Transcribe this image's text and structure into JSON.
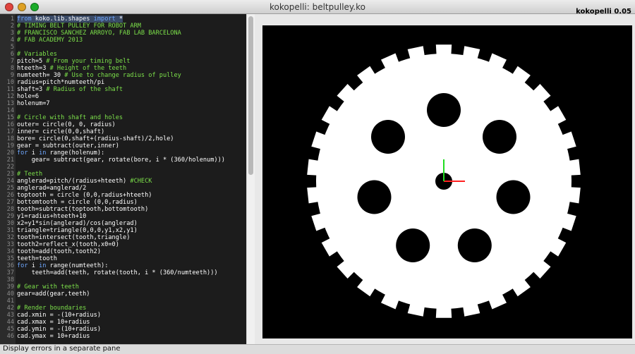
{
  "window": {
    "title": "kokopelli:  beltpulley.ko"
  },
  "app_label": "kokopelli 0.05",
  "status_text": "Display errors in a separate pane",
  "editor": {
    "line_numbers": [
      "1",
      "2",
      "3",
      "4",
      "5",
      "6",
      "7",
      "8",
      "9",
      "10",
      "11",
      "12",
      "13",
      "14",
      "15",
      "16",
      "17",
      "18",
      "19",
      "20",
      "21",
      "22",
      "23",
      "24",
      "25",
      "26",
      "27",
      "28",
      "29",
      "30",
      "31",
      "32",
      "33",
      "34",
      "35",
      "36",
      "37",
      "38",
      "39",
      "40",
      "41",
      "42",
      "43",
      "44",
      "45",
      "46"
    ],
    "lines": [
      [
        {
          "t": "from",
          "s": "k"
        },
        {
          "t": " koko.lib.shapes ",
          "s": "p"
        },
        {
          "t": "import",
          "s": "k"
        },
        {
          "t": " *",
          "s": "p"
        }
      ],
      [
        {
          "t": "# TIMING BELT PULLEY FOR ROBOT ARM",
          "s": "c"
        }
      ],
      [
        {
          "t": "# FRANCISCO SANCHEZ ARROYO, FAB LAB BARCELONA",
          "s": "c"
        }
      ],
      [
        {
          "t": "# FAB ACADEMY 2013",
          "s": "c"
        }
      ],
      [],
      [
        {
          "t": "# Variables",
          "s": "c"
        }
      ],
      [
        {
          "t": "pitch=5 ",
          "s": "p"
        },
        {
          "t": "# From your timing belt",
          "s": "c"
        }
      ],
      [
        {
          "t": "hteeth=3 ",
          "s": "p"
        },
        {
          "t": "# Height of the teeth",
          "s": "c"
        }
      ],
      [
        {
          "t": "numteeth= 30 ",
          "s": "p"
        },
        {
          "t": "# Use to change radius of pulley",
          "s": "c"
        }
      ],
      [
        {
          "t": "radius=pitch*numteeth/pi",
          "s": "p"
        }
      ],
      [
        {
          "t": "shaft=3 ",
          "s": "p"
        },
        {
          "t": "# Radius of the shaft",
          "s": "c"
        }
      ],
      [
        {
          "t": "hole=6",
          "s": "p"
        }
      ],
      [
        {
          "t": "holenum=7",
          "s": "p"
        }
      ],
      [],
      [
        {
          "t": "# Circle with shaft and holes",
          "s": "c"
        }
      ],
      [
        {
          "t": "outer= circle(0, 0, radius)",
          "s": "p"
        }
      ],
      [
        {
          "t": "inner= circle(0,0,shaft)",
          "s": "p"
        }
      ],
      [
        {
          "t": "bore= circle(0,shaft+(radius-shaft)/2,hole)",
          "s": "p"
        }
      ],
      [
        {
          "t": "gear = subtract(outer,inner)",
          "s": "p"
        }
      ],
      [
        {
          "t": "for",
          "s": "k"
        },
        {
          "t": " i ",
          "s": "p"
        },
        {
          "t": "in",
          "s": "k"
        },
        {
          "t": " range(holenum):",
          "s": "p"
        }
      ],
      [
        {
          "t": "    gear= subtract(gear, rotate(bore, i * (360/holenum)))",
          "s": "p"
        }
      ],
      [],
      [
        {
          "t": "# Teeth",
          "s": "c"
        }
      ],
      [
        {
          "t": "anglerad=pitch/(radius+hteeth) ",
          "s": "p"
        },
        {
          "t": "#CHECK",
          "s": "c"
        }
      ],
      [
        {
          "t": "anglerad=anglerad/2",
          "s": "p"
        }
      ],
      [
        {
          "t": "toptooth = circle (0,0,radius+hteeth)",
          "s": "p"
        }
      ],
      [
        {
          "t": "bottomtooth = circle (0,0,radius)",
          "s": "p"
        }
      ],
      [
        {
          "t": "tooth=subtract(toptooth,bottomtooth)",
          "s": "p"
        }
      ],
      [
        {
          "t": "y1=radius+hteeth+10",
          "s": "p"
        }
      ],
      [
        {
          "t": "x2=y1*sin(anglerad)/cos(anglerad)",
          "s": "p"
        }
      ],
      [
        {
          "t": "triangle=triangle(0,0,0,y1,x2,y1)",
          "s": "p"
        }
      ],
      [
        {
          "t": "tooth=intersect(tooth,triangle)",
          "s": "p"
        }
      ],
      [
        {
          "t": "tooth2=reflect_x(tooth,x0=0)",
          "s": "p"
        }
      ],
      [
        {
          "t": "tooth=add(tooth,tooth2)",
          "s": "p"
        }
      ],
      [
        {
          "t": "teeth=tooth",
          "s": "p"
        }
      ],
      [
        {
          "t": "for",
          "s": "k"
        },
        {
          "t": " i ",
          "s": "p"
        },
        {
          "t": "in",
          "s": "k"
        },
        {
          "t": " range(numteeth):",
          "s": "p"
        }
      ],
      [
        {
          "t": "    teeth=add(teeth, rotate(tooth, i * (360/numteeth)))",
          "s": "p"
        }
      ],
      [],
      [
        {
          "t": "# Gear with teeth",
          "s": "c"
        }
      ],
      [
        {
          "t": "gear=add(gear,teeth)",
          "s": "p"
        }
      ],
      [],
      [
        {
          "t": "# Render boundaries",
          "s": "c"
        }
      ],
      [
        {
          "t": "cad.xmin = -(10+radius)",
          "s": "p"
        }
      ],
      [
        {
          "t": "cad.xmax = 10+radius",
          "s": "p"
        }
      ],
      [
        {
          "t": "cad.ymin = -(10+radius)",
          "s": "p"
        }
      ],
      [
        {
          "t": "cad.ymax = 10+radius",
          "s": "p"
        }
      ]
    ]
  },
  "colors": {
    "editor_bg": "#1c1c1c",
    "keyword": "#6fa8ff",
    "comment": "#7ce04a",
    "plain": "#ffffff",
    "viewer_bg": "#000000",
    "shape": "#ffffff",
    "axis_x": "#ff2020",
    "axis_y": "#20dd20"
  },
  "render": {
    "teeth_count": 30,
    "hole_count": 7
  }
}
